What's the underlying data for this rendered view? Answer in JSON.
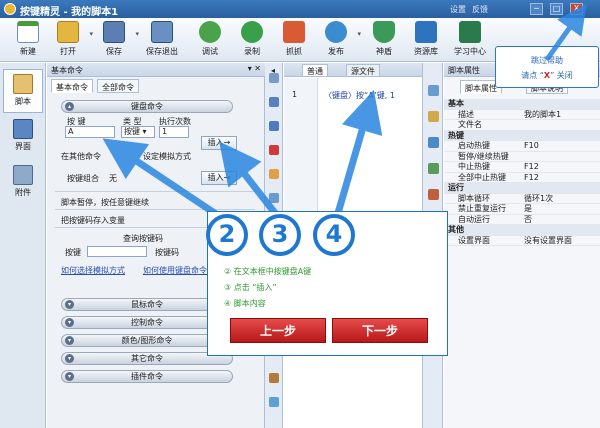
{
  "window": {
    "app_name": "按键精灵",
    "script_name": "我的脚本1",
    "title_sep": "-",
    "menu_settings": "设置",
    "menu_feedback": "反馈",
    "min_glyph": "─",
    "max_glyph": "□",
    "close_glyph": "X"
  },
  "toolbar": {
    "buttons": [
      {
        "label": "新建"
      },
      {
        "label": "打开"
      },
      {
        "label": "保存"
      },
      {
        "label": "保存退出"
      },
      {
        "label": "调试"
      },
      {
        "label": "录制"
      },
      {
        "label": "抓抓"
      },
      {
        "label": "发布"
      },
      {
        "label": "神盾"
      },
      {
        "label": "资源库"
      },
      {
        "label": "学习中心"
      }
    ],
    "dropdown_glyph": "▾"
  },
  "leftnav": {
    "items": [
      {
        "label": "脚本"
      },
      {
        "label": "界面"
      },
      {
        "label": "附件"
      }
    ]
  },
  "cmd_panel": {
    "title": "基本命令",
    "pin": "▾ ✕",
    "tabs": [
      "基本命令",
      "全部命令"
    ],
    "keyboard_group": "键盘命令",
    "col_key": "按 键",
    "col_type": "类 型",
    "col_times": "执行次数",
    "key_value": "A",
    "type_value": "按键",
    "times_value": "1",
    "insert_label": "插入→",
    "text_mode_prefix": "在其他命令",
    "text_mode_suffix": "设定模拟方式",
    "combo_label": "按键组合",
    "combo_value": "无",
    "pause_label": "脚本暂停，按任意键继续",
    "save_key_label": "把按键码存入变量",
    "query_group": "查询按键码",
    "query_key": "按键",
    "query_code": "按键码",
    "link1": "如何选择模拟方式",
    "link2": "如何使用键盘命令",
    "groups": [
      "鼠标命令",
      "控制命令",
      "颜色/图形命令",
      "其它命令",
      "插件命令"
    ]
  },
  "editor": {
    "tabs": [
      "普通",
      "源文件"
    ],
    "collapse": "◂",
    "line_no": "1",
    "line1": "〈键盘〉按“A”键, 1"
  },
  "props": {
    "title": "脚本属性",
    "tabs": [
      "脚本属性",
      "脚本说明"
    ],
    "rows": [
      {
        "k": "基本",
        "v": "",
        "cat": true
      },
      {
        "k": "描述",
        "v": "我的脚本1"
      },
      {
        "k": "文件名",
        "v": ""
      },
      {
        "k": "热键",
        "v": "",
        "cat": true
      },
      {
        "k": "启动热键",
        "v": "F10"
      },
      {
        "k": "暂停/继续热键",
        "v": ""
      },
      {
        "k": "中止热键",
        "v": "F12"
      },
      {
        "k": "全部中止热键",
        "v": "F12"
      },
      {
        "k": "运行",
        "v": "",
        "cat": true
      },
      {
        "k": "脚本循环",
        "v": "循环1次"
      },
      {
        "k": "禁止重复运行",
        "v": "是"
      },
      {
        "k": "自动运行",
        "v": "否"
      },
      {
        "k": "其他",
        "v": "",
        "cat": true
      },
      {
        "k": "设置界面",
        "v": "没有设置界面"
      }
    ]
  },
  "help_tip": {
    "line1": "跳过帮助",
    "line2_pre": "请点 “",
    "line2_x": "X",
    "line2_post": "” 关闭"
  },
  "guide": {
    "steps": [
      "② 在文本框中按键盘A键",
      "③ 点击 “插入”",
      "④ 脚本内容"
    ],
    "prev": "上一步",
    "next": "下一步",
    "badges": [
      "2",
      "3",
      "4"
    ]
  },
  "colors": {
    "accent": "#1e78d2",
    "title_bar": "#2a5f9e",
    "step_text": "#2e9a2e",
    "button_red": "#c62828"
  }
}
